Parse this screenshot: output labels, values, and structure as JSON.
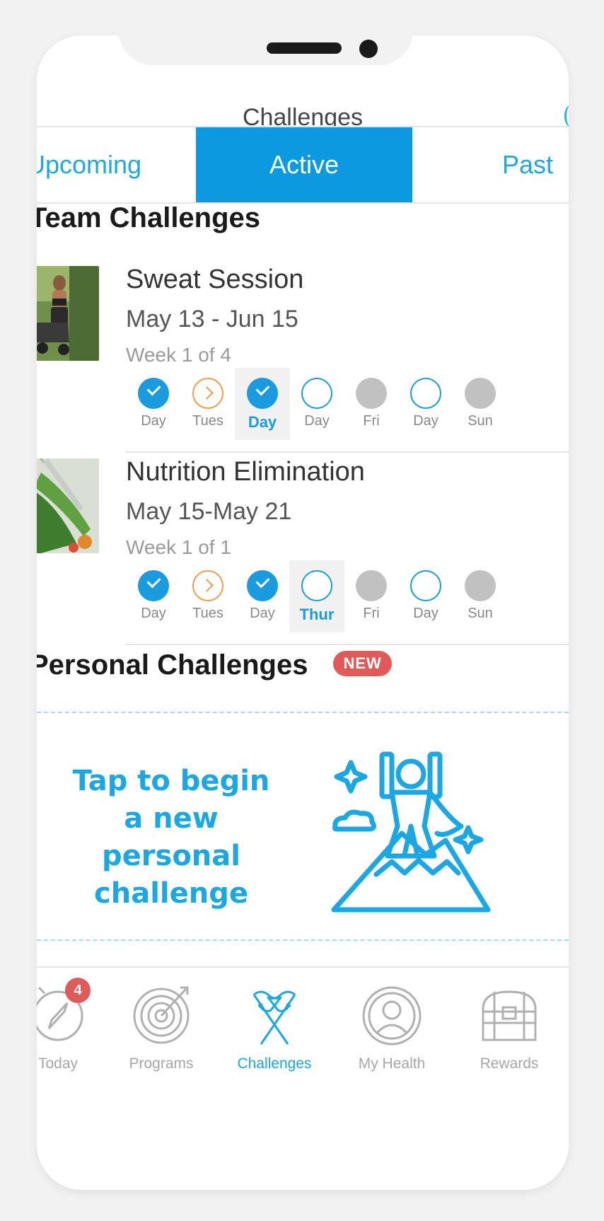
{
  "header": {
    "title": "Challenges"
  },
  "tabs": [
    {
      "label": "Upcoming"
    },
    {
      "label": "Active",
      "selected": true
    },
    {
      "label": "Past"
    }
  ],
  "team_section": {
    "title": "Team Challenges"
  },
  "challenges": [
    {
      "name": "Sweat Session",
      "dates": "May 13 - Jun 15",
      "week": "Week 1 of 4",
      "days": [
        {
          "label": "Day",
          "status": "done"
        },
        {
          "label": "Tues",
          "status": "pending"
        },
        {
          "label": "Day",
          "status": "done",
          "selected": true
        },
        {
          "label": "Day",
          "status": "open"
        },
        {
          "label": "Fri",
          "status": "off"
        },
        {
          "label": "Day",
          "status": "open"
        },
        {
          "label": "Sun",
          "status": "off"
        }
      ]
    },
    {
      "name": "Nutrition Elimination",
      "dates": "May 15-May 21",
      "week": "Week 1 of 1",
      "days": [
        {
          "label": "Day",
          "status": "done"
        },
        {
          "label": "Tues",
          "status": "pending"
        },
        {
          "label": "Day",
          "status": "done"
        },
        {
          "label": "Thur",
          "status": "open",
          "selected": true
        },
        {
          "label": "Fri",
          "status": "off"
        },
        {
          "label": "Day",
          "status": "open"
        },
        {
          "label": "Sun",
          "status": "off"
        }
      ]
    }
  ],
  "personal_section": {
    "title": "Personal Challenges",
    "badge": "NEW"
  },
  "personal_card": {
    "text": "Tap to begin a new personal challenge",
    "icon": "summit-hero-icon"
  },
  "bottom_nav": [
    {
      "label": "Today",
      "icon": "compass-icon",
      "badge": "4"
    },
    {
      "label": "Programs",
      "icon": "target-icon"
    },
    {
      "label": "Challenges",
      "icon": "flags-icon",
      "active": true
    },
    {
      "label": "My Health",
      "icon": "face-icon"
    },
    {
      "label": "Rewards",
      "icon": "treasure-chest-icon"
    }
  ],
  "colors": {
    "accent": "#0b9ae0",
    "accent_text": "#1ba6e4",
    "pending": "#f29a4a",
    "badge": "#e05a5a",
    "inactive": "#c1c1c1"
  }
}
